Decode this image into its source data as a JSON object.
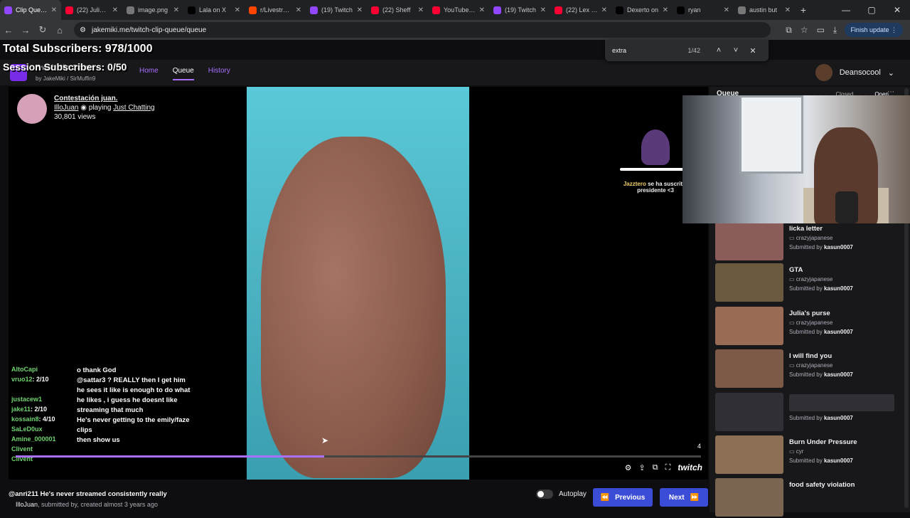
{
  "browser": {
    "tabs": [
      {
        "title": "Clip Queue",
        "color": "#9146ff",
        "active": true
      },
      {
        "title": "(22) Julia G",
        "color": "#ff0033"
      },
      {
        "title": "image.png",
        "color": "#777777"
      },
      {
        "title": "Lala on X",
        "color": "#000000"
      },
      {
        "title": "r/Livestream",
        "color": "#ff4500"
      },
      {
        "title": "(19) Twitch",
        "color": "#9146ff"
      },
      {
        "title": "(22) Sheff",
        "color": "#ff0033"
      },
      {
        "title": "YouTube M",
        "color": "#ff0033"
      },
      {
        "title": "(19) Twitch",
        "color": "#9146ff"
      },
      {
        "title": "(22) Lex Lu",
        "color": "#ff0033"
      },
      {
        "title": "Dexerto on",
        "color": "#000000"
      },
      {
        "title": "ryan",
        "color": "#000000"
      },
      {
        "title": "austin but",
        "color": "#777777"
      }
    ],
    "url": "jakemiki.me/twitch-clip-queue/queue",
    "finish_update": "Finish update",
    "find": {
      "query": "extra",
      "count": "1/42"
    }
  },
  "overlay": {
    "total_subs": "Total Subscribers: 978/1000",
    "session_subs": "Session Subscribers: 0/50"
  },
  "site": {
    "brand": "Twitch Clip Queue",
    "by": "by",
    "author1": "JakeMiki",
    "author2": "SirMuffin9",
    "nav": [
      "Home",
      "Queue",
      "History"
    ],
    "username": "Deansocool"
  },
  "clip": {
    "title": "Contestación juan.",
    "channel": "IlloJuan",
    "playing": "playing",
    "game": "Just Chatting",
    "views": "30,801 views",
    "progress": 0.45,
    "page_num": "4",
    "submitted_by": "IlloJuan",
    "submitted_text": ", submitted by",
    "created": ", created almost 3 years ago"
  },
  "alert": {
    "name": "Jazztero",
    "text": "se ha suscrito,",
    "text2": "presidente <3"
  },
  "chat": [
    {
      "user": "AltoCapi",
      "text": ""
    },
    {
      "user": "vruo12",
      "text": "2/10"
    },
    {
      "user": "",
      "text": ""
    },
    {
      "user": "justacew1",
      "text": ""
    },
    {
      "user": "jake11",
      "text": "2/10"
    },
    {
      "user": "kossain8",
      "text": "4/10"
    },
    {
      "user": "SaLeD0ux",
      "text": ""
    },
    {
      "user": "Amine_000001",
      "text": ""
    },
    {
      "user": "Clivent",
      "text": ""
    },
    {
      "user": "Clivent",
      "text": ""
    }
  ],
  "chat_big": [
    "o thank God",
    "@sattar3 ? REALLY then I get him he sees it like is enough to do what he likes , i guess he doesnt like streaming that much",
    "He's never getting to the emily/faze clips",
    "then show us"
  ],
  "bottom_chat": "@anri211 He's never streamed consistently really",
  "controls": {
    "autoplay": "Autoplay",
    "previous": "Previous",
    "next": "Next",
    "brand": "twitch"
  },
  "queue": {
    "header": "Queue",
    "tabs": [
      "Closed",
      "Open"
    ],
    "items": [
      {
        "title": "licka letter",
        "channel": "crazyjapanese",
        "submitted": "Submitted by",
        "by": "kasun0007",
        "thumb": "#8a5d5a"
      },
      {
        "title": "GTA",
        "channel": "crazyjapanese",
        "submitted": "Submitted by",
        "by": "kasun0007",
        "thumb": "#6b5a40"
      },
      {
        "title": "Julia's purse",
        "channel": "crazyjapanese",
        "submitted": "Submitted by",
        "by": "kasun0007",
        "thumb": "#9a6b55"
      },
      {
        "title": "I will find you",
        "channel": "crazyjapanese",
        "submitted": "Submitted by",
        "by": "kasun0007",
        "thumb": "#7d5a48"
      },
      {
        "title": "",
        "channel": "",
        "submitted": "Submitted by",
        "by": "kasun0007",
        "thumb": "#2f2f35"
      },
      {
        "title": "Burn Under Pressure",
        "channel": "cyr",
        "submitted": "Submitted by",
        "by": "kasun0007",
        "thumb": "#8d6f55"
      },
      {
        "title": "food safety violation",
        "channel": "",
        "submitted": "",
        "by": "",
        "thumb": "#7a6650"
      }
    ]
  }
}
